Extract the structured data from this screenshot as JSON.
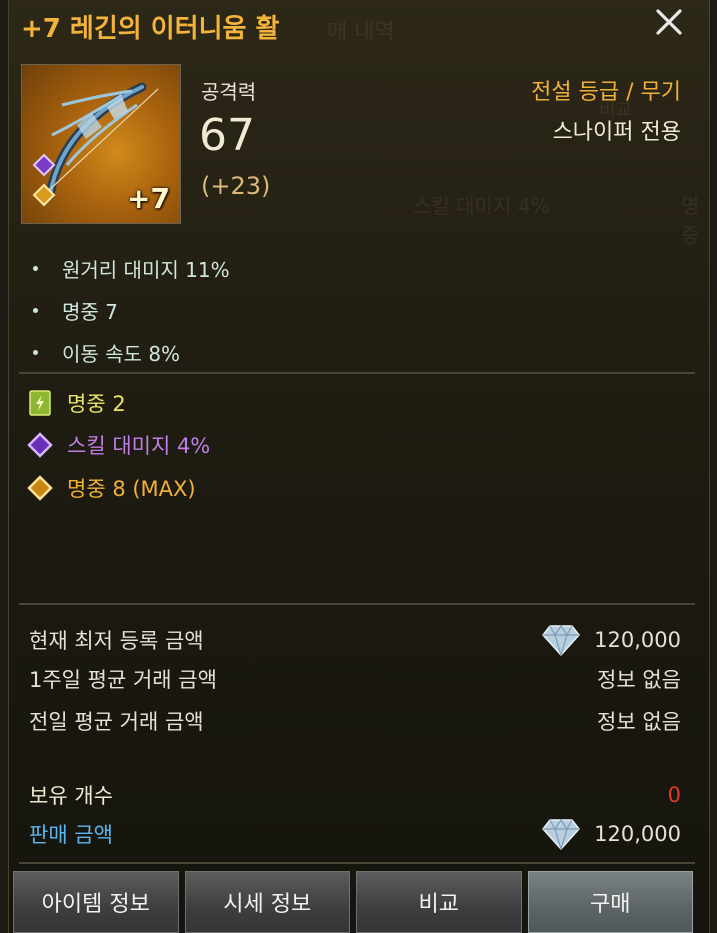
{
  "title": "+7 레긴의 이터니움 활",
  "item": {
    "plus": "+7"
  },
  "attack": {
    "label": "공격력",
    "value": "67",
    "bonus": "(+23)"
  },
  "grade": "전설 등급 / 무기",
  "class_only": "스나이퍼 전용",
  "base_stats": [
    "원거리 대미지 11%",
    "명중 7",
    "이동 속도 8%"
  ],
  "effects": [
    {
      "text": "명중 2",
      "icon": "rune-card-icon",
      "color": "#e9e36a"
    },
    {
      "text": "스킬 대미지 4%",
      "icon": "purple-diamond-icon",
      "color": "#c07ee8"
    },
    {
      "text": "명중 8 (MAX)",
      "icon": "gold-diamond-icon",
      "color": "#f0b13a"
    }
  ],
  "prices": {
    "lowest_label": "현재 최저 등록 금액",
    "lowest_value": "120,000",
    "week_label": "1주일 평균 거래 금액",
    "week_value": "정보 없음",
    "yesterday_label": "전일 평균 거래 금액",
    "yesterday_value": "정보 없음"
  },
  "owned": {
    "label": "보유 개수",
    "value": "0",
    "value_color": "#e03a2a"
  },
  "sale": {
    "label": "판매 금액",
    "value": "120,000",
    "label_color": "#5cb7f0"
  },
  "buttons": [
    "아이템 정보",
    "시세 정보",
    "비교",
    "구매"
  ],
  "ghost_text": [
    "매 내역",
    "비교",
    "스킬 대미지 4%",
    "명중"
  ]
}
